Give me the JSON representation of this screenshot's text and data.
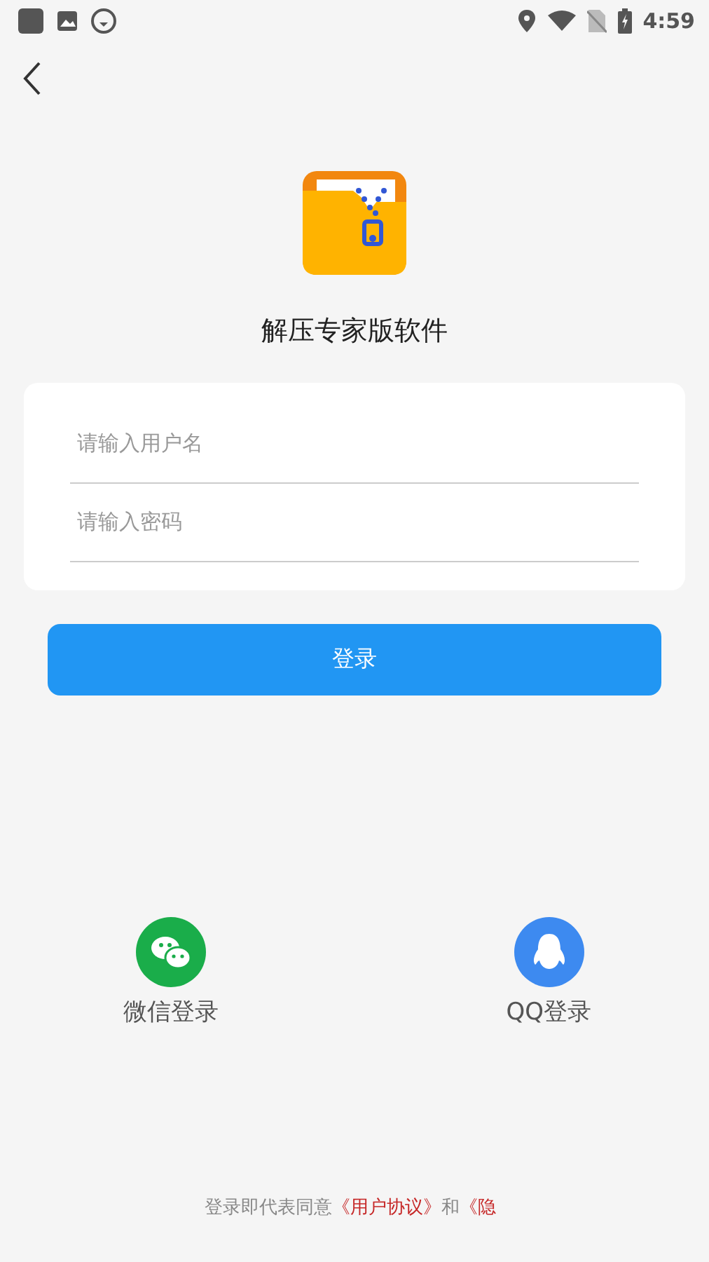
{
  "status_bar": {
    "time": "4:59"
  },
  "app": {
    "name": "解压专家版软件"
  },
  "form": {
    "fields": [
      {
        "placeholder": "请输入用户名"
      },
      {
        "placeholder": "请输入密码"
      }
    ],
    "submit": "登录"
  },
  "social_logins": [
    {
      "kind": "wechat",
      "label": "微信登录",
      "color": "#1aad4a"
    },
    {
      "kind": "qq",
      "label": "QQ登录",
      "color": "#3d8af0"
    }
  ],
  "agreement": [
    {
      "kind": "text",
      "text": "登录即代表同意"
    },
    {
      "kind": "link",
      "text": "《用户协议》"
    },
    {
      "kind": "text",
      "text": "和"
    },
    {
      "kind": "link",
      "text": "《隐"
    }
  ]
}
